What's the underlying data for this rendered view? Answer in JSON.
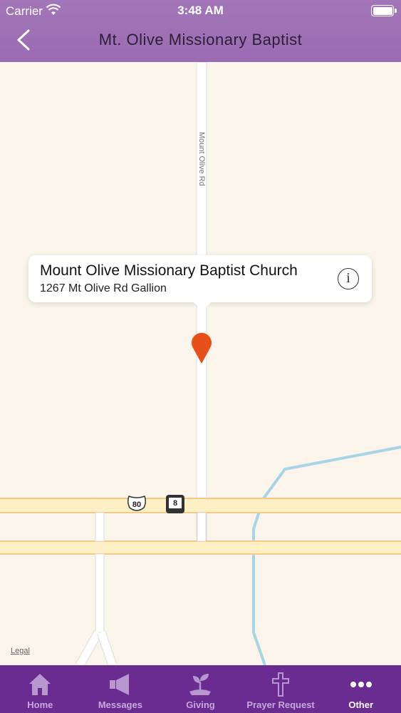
{
  "status_bar": {
    "carrier": "Carrier",
    "time": "3:48 AM"
  },
  "nav": {
    "title": "Mt. Olive Missionary Baptist"
  },
  "map": {
    "road_label": "Mount Olive Rd",
    "shield_us": "80",
    "shield_state": "8",
    "legal": "Legal",
    "callout": {
      "name": "Mount Olive Missionary Baptist Church",
      "address": "1267 Mt Olive Rd Gallion"
    },
    "pin_color": "#e8501a"
  },
  "tabs": [
    {
      "label": "Home",
      "icon": "home-icon"
    },
    {
      "label": "Messages",
      "icon": "megaphone-icon"
    },
    {
      "label": "Giving",
      "icon": "plant-icon"
    },
    {
      "label": "Prayer Request",
      "icon": "cross-icon"
    },
    {
      "label": "Other",
      "icon": "more-icon",
      "active": true
    }
  ],
  "colors": {
    "header": "#9b6bb3",
    "tabbar": "#6a2c91",
    "tab_inactive": "#c7a9d8"
  }
}
